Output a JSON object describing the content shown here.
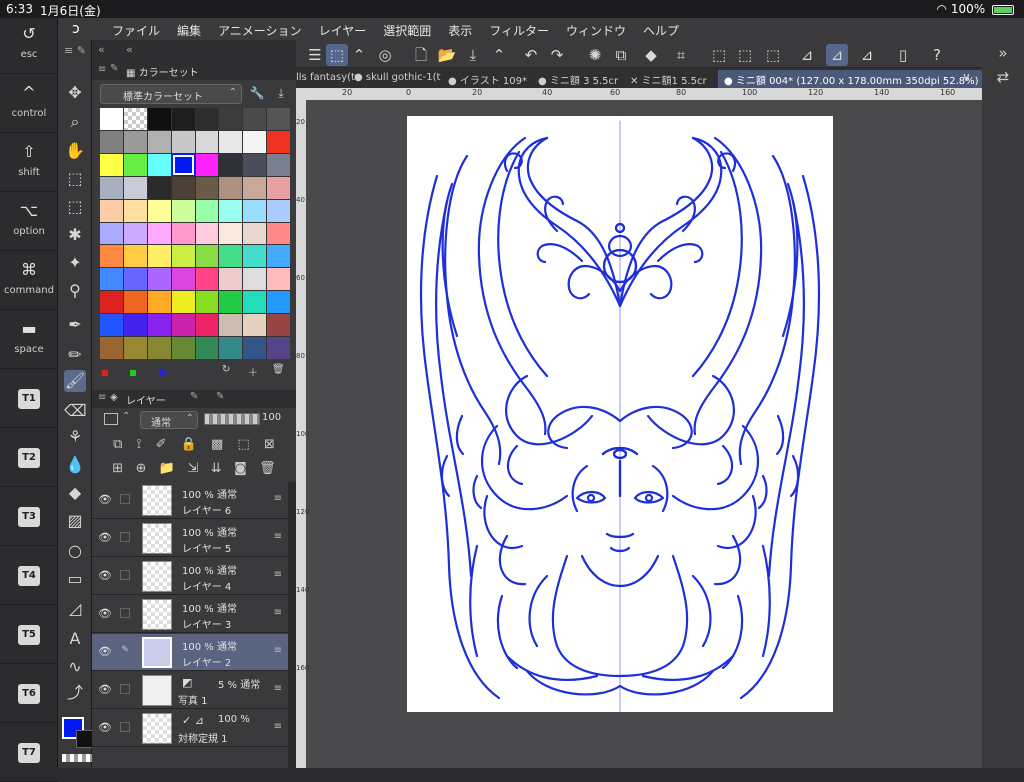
{
  "status": {
    "time": "6:33",
    "date": "1月6日(金)",
    "battery": "100%"
  },
  "menu": [
    "ファイル",
    "編集",
    "アニメーション",
    "レイヤー",
    "選択範囲",
    "表示",
    "フィルター",
    "ウィンドウ",
    "ヘルプ"
  ],
  "keys": [
    {
      "icon": "↺",
      "label": "esc"
    },
    {
      "icon": "^",
      "label": "control"
    },
    {
      "icon": "⇧",
      "label": "shift"
    },
    {
      "icon": "⌥",
      "label": "option"
    },
    {
      "icon": "⌘",
      "label": "command"
    },
    {
      "icon": "▬",
      "label": "space"
    },
    {
      "badge": "T1"
    },
    {
      "badge": "T2"
    },
    {
      "badge": "T3"
    },
    {
      "badge": "T4"
    },
    {
      "badge": "T5"
    },
    {
      "badge": "T6"
    },
    {
      "badge": "T7"
    }
  ],
  "color_panel": {
    "tab": "カラーセット",
    "set_name": "標準カラーセット"
  },
  "layer_panel": {
    "tab": "レイヤー",
    "blend_mode": "通常",
    "opacity": "100"
  },
  "layers": [
    {
      "opacity": "100 % 通常",
      "name": "レイヤー 6"
    },
    {
      "opacity": "100 % 通常",
      "name": "レイヤー 5"
    },
    {
      "opacity": "100 % 通常",
      "name": "レイヤー 4"
    },
    {
      "opacity": "100 % 通常",
      "name": "レイヤー 3"
    },
    {
      "opacity": "100 % 通常",
      "name": "レイヤー 2",
      "selected": true
    },
    {
      "opacity": "5 % 通常",
      "name": "写真 1"
    },
    {
      "opacity": "100 %",
      "name": "対称定規 1"
    }
  ],
  "tabs": [
    {
      "label": "lls fantasy(t"
    },
    {
      "label": "● skull gothic-1(t"
    },
    {
      "label": "● イラスト 109*"
    },
    {
      "label": "● ミニ額 3  5.5cr"
    },
    {
      "label": "✕ ミニ額1  5.5cr"
    },
    {
      "label": "● ミニ額 004* (127.00 x 178.00mm 350dpi 52.8%)",
      "active": true
    }
  ],
  "ruler_h": [
    "20",
    "0",
    "20",
    "40",
    "60",
    "80",
    "100",
    "120",
    "140",
    "160"
  ],
  "ruler_v": [
    "20",
    "40",
    "60",
    "80",
    "100",
    "120",
    "140",
    "160"
  ],
  "palette": [
    "#ffffff",
    "checker",
    "#101010",
    "#1e1e1e",
    "#2e2e2e",
    "#3c3c3c",
    "#4a4a4a",
    "#555555",
    "#808080",
    "#9a9a9a",
    "#b0b0b0",
    "#c8c8c8",
    "#d8d8d8",
    "#e8e8e8",
    "#f4f4f4",
    "#ee3322",
    "#ffff44",
    "#66ee44",
    "#66ffff",
    "#0019f2",
    "#ff22ff",
    "#303038",
    "#4a4e58",
    "#7a8090",
    "#a8b0c0",
    "#c8ccd8",
    "#2a2a2a",
    "#4a4038",
    "#6a5a48",
    "#b09080",
    "#c8a898",
    "#e8a0a0",
    "#ffccaa",
    "#ffe0a0",
    "#ffff99",
    "#ccff99",
    "#99ffaa",
    "#99ffee",
    "#99ddff",
    "#aaccff",
    "#aaaaff",
    "#ccaaff",
    "#ffaaff",
    "#ff99cc",
    "#ffccdd",
    "#f8e8e0",
    "#e8d8d0",
    "#ff8888",
    "#ff8844",
    "#ffcc44",
    "#ffee66",
    "#ccee44",
    "#88dd44",
    "#44dd88",
    "#44ddcc",
    "#44aaff",
    "#4488ff",
    "#6666ff",
    "#aa66ff",
    "#dd44dd",
    "#ff4488",
    "#eecccc",
    "#dddddd",
    "#ffbbbb",
    "#dd2222",
    "#ee6622",
    "#ffaa22",
    "#eeee22",
    "#88dd22",
    "#22cc44",
    "#22ddbb",
    "#2299ff",
    "#2255ff",
    "#4422ee",
    "#8822ee",
    "#cc22aa",
    "#ee2266",
    "#ccbbb0",
    "#e8d0c0",
    "#994444",
    "#996633",
    "#998833",
    "#888833",
    "#668833",
    "#338855",
    "#338888",
    "#335588",
    "#554488"
  ],
  "colors": {
    "accent": "#5a6b8c",
    "main_color": "#0019f2",
    "line": "#1e2fd9"
  }
}
